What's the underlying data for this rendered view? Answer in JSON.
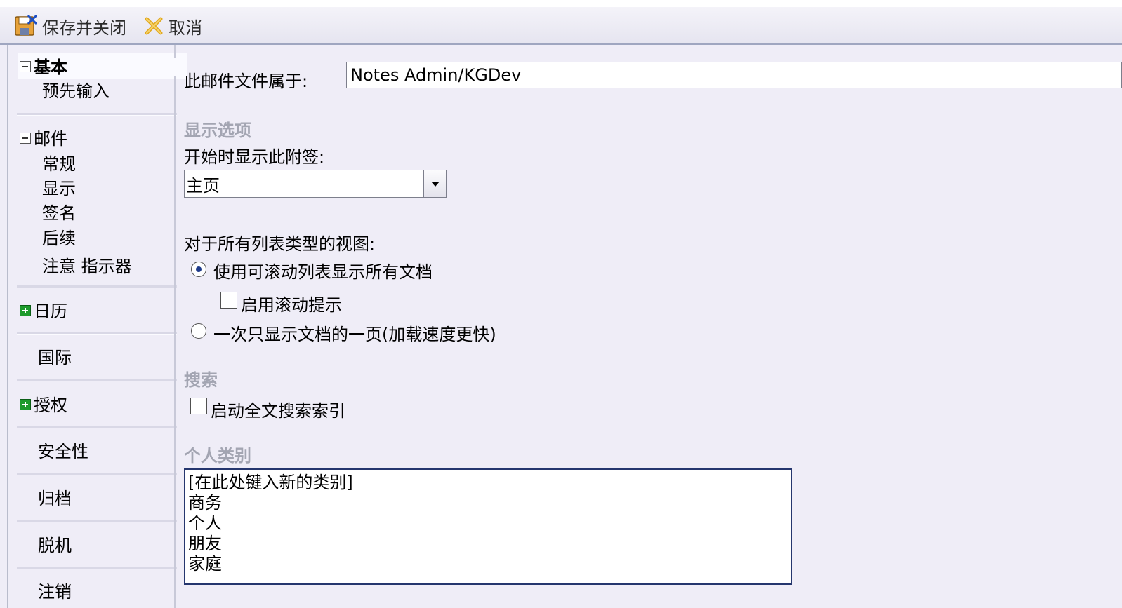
{
  "toolbar": {
    "save_close_label": "保存并关闭",
    "cancel_label": "取消"
  },
  "sidebar": {
    "basic": {
      "label": "基本",
      "children": [
        "预先输入"
      ]
    },
    "mail": {
      "label": "邮件",
      "children": [
        "常规",
        "显示",
        "签名",
        "后续",
        "注意 指示器"
      ]
    },
    "calendar": "日历",
    "international": "国际",
    "delegation": "授权",
    "security": "安全性",
    "archive": "归档",
    "offline": "脱机",
    "logout": "注销"
  },
  "main": {
    "owner_label": "此邮件文件属于:",
    "owner_value": "Notes Admin/KGDev",
    "display_section": "显示选项",
    "start_tab_label": "开始时显示此附签:",
    "start_tab_value": "主页",
    "list_views_label": "对于所有列表类型的视图:",
    "radio_scroll": {
      "label": "使用可滚动列表显示所有文档",
      "checked": true
    },
    "check_scroll_hints": {
      "label": "启用滚动提示",
      "checked": false
    },
    "radio_page": {
      "label": "一次只显示文档的一页(加载速度更快)",
      "checked": false
    },
    "search_section": "搜索",
    "check_fulltext": {
      "label": "启动全文搜索索引",
      "checked": false
    },
    "categories_section": "个人类别",
    "categories": [
      "[在此处键入新的类别]",
      "商务",
      "个人",
      "朋友",
      "家庭"
    ]
  }
}
